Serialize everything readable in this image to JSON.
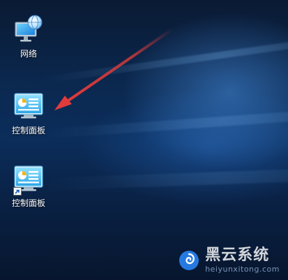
{
  "desktop": {
    "icons": [
      {
        "label": "网络",
        "icon": "network-computer-globe-icon",
        "shortcut": false
      },
      {
        "label": "控制面板",
        "icon": "control-panel-icon",
        "shortcut": false
      },
      {
        "label": "控制面板",
        "icon": "control-panel-icon",
        "shortcut": true
      }
    ]
  },
  "annotation": {
    "color": "#e23b3b",
    "points_to": "控制面板"
  },
  "watermark": {
    "title": "黑云系统",
    "subtitle": "heiyunxitong.com",
    "logo": "swirl-logo-icon",
    "accent": "#2a8bff"
  }
}
